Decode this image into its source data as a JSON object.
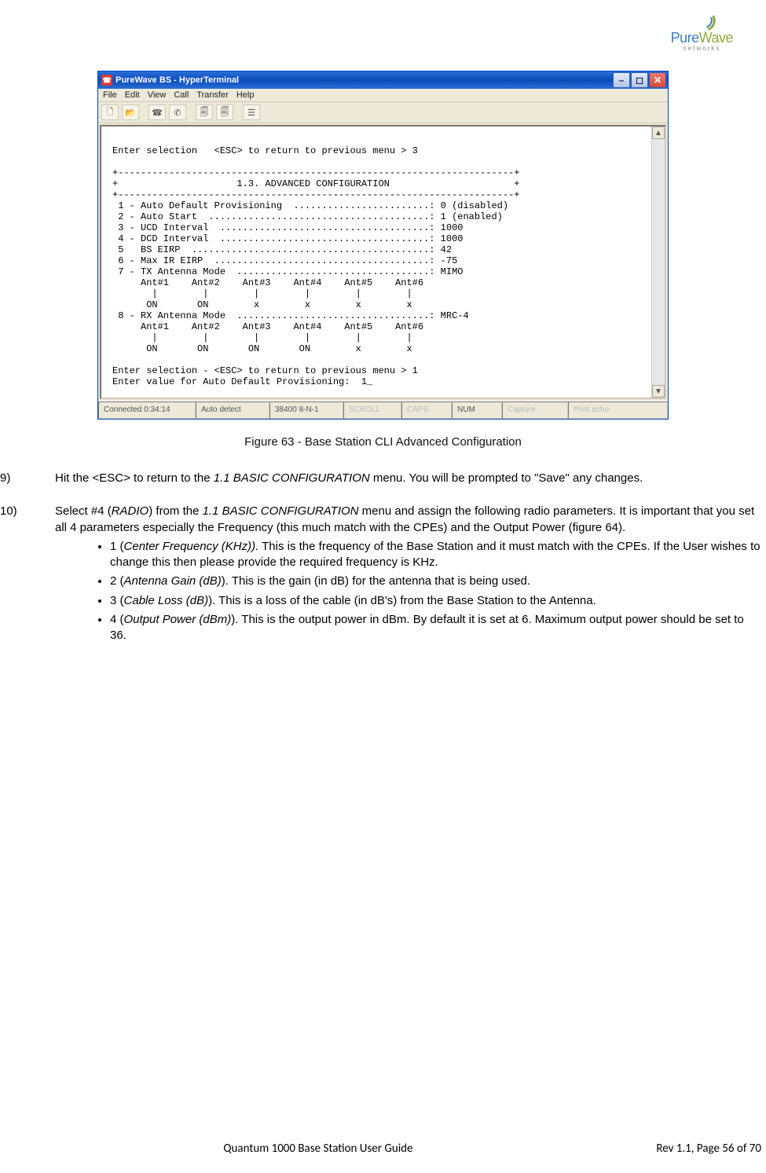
{
  "logo": {
    "pure": "Pure",
    "wave": "Wave",
    "sub": "networks"
  },
  "ht": {
    "title": "PureWave BS - HyperTerminal",
    "menu": [
      "File",
      "Edit",
      "View",
      "Call",
      "Transfer",
      "Help"
    ],
    "toolbar_icons": [
      "new-icon",
      "open-icon",
      "save-icon",
      "disconnect-icon",
      "copy-icon",
      "paste-icon",
      "props-icon"
    ],
    "terminal": "\nEnter selection   <ESC> to return to previous menu > 3\n\n+----------------------------------------------------------------------+\n+                     1.3. ADVANCED CONFIGURATION                      +\n+----------------------------------------------------------------------+\n 1 - Auto Default Provisioning  ........................: 0 (disabled)\n 2 - Auto Start  .......................................: 1 (enabled)\n 3 - UCD Interval  .....................................: 1000\n 4 - DCD Interval  .....................................: 1000\n 5   BS EIRP  ..........................................: 42\n 6 - Max IR EIRP  ......................................: -75\n 7 - TX Antenna Mode  ..................................: MIMO\n     Ant#1    Ant#2    Ant#3    Ant#4    Ant#5    Ant#6\n       |        |        |        |        |        |\n      ON       ON        x        x        x        x\n 8 - RX Antenna Mode  ..................................: MRC-4\n     Ant#1    Ant#2    Ant#3    Ant#4    Ant#5    Ant#6\n       |        |        |        |        |        |\n      ON       ON       ON       ON        x        x\n\nEnter selection - <ESC> to return to previous menu > 1\nEnter value for Auto Default Provisioning:  1_",
    "status": {
      "conn": "Connected 0:34:14",
      "auto": "Auto detect",
      "baud": "38400 8-N-1",
      "scroll": "SCROLL",
      "caps": "CAPS",
      "num": "NUM",
      "capture": "Capture",
      "echo": "Print echo"
    }
  },
  "caption": "Figure 63 - Base Station CLI Advanced Configuration",
  "step9": {
    "num": "9)",
    "text_a": "Hit the <ESC> to return to the ",
    "text_i": "1.1 BASIC CONFIGURATION",
    "text_b": " menu. You will be prompted to \"Save\" any changes."
  },
  "step10": {
    "num": "10)",
    "intro_a": "Select #4 (",
    "intro_i": "RADIO",
    "intro_b": ") from the ",
    "intro_i2": "1.1 BASIC CONFIGURATION",
    "intro_c": " menu and assign the following radio parameters. It is important that you set all 4 parameters especially the Frequency (this much match with the CPEs) and the Output Power (figure 64).",
    "bullets": [
      {
        "pre": "1 (",
        "it": "Center Frequency (KHz)).",
        "post": " This is the frequency of the Base Station and it must match with the CPEs. If the User wishes to change this then please provide the required frequency is KHz."
      },
      {
        "pre": "2 (",
        "it": "Antenna Gain (dB)",
        "post": "). This is the gain (in dB) for the antenna that is being used."
      },
      {
        "pre": "3 (",
        "it": "Cable Loss (dB)",
        "post": "). This is a loss of the cable (in dB's) from the Base Station to the Antenna."
      },
      {
        "pre": "4 (",
        "it": "Output Power (dBm)",
        "post": "). This is the output power in dBm. By default it is set at 6. Maximum output power should be set to 36."
      }
    ]
  },
  "footer": {
    "title": "Quantum 1000 Base Station User Guide",
    "rev": "Rev 1.1, Page 56 of 70"
  }
}
